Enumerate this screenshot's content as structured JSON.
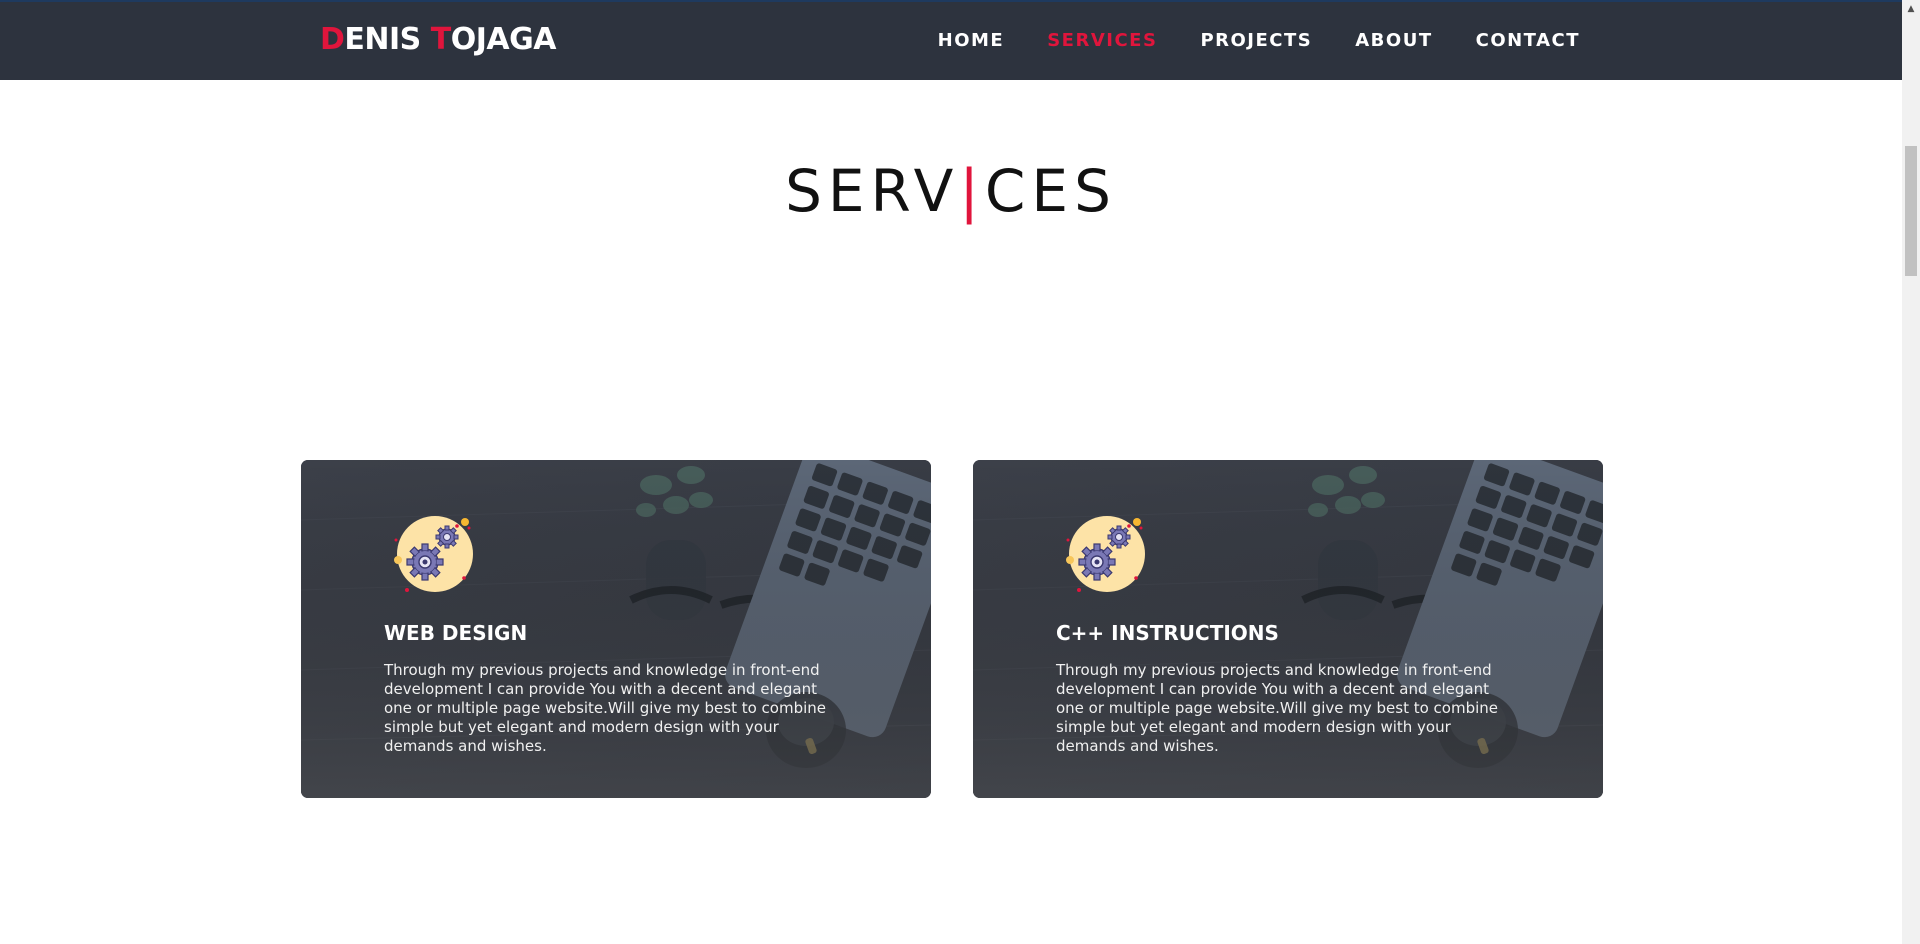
{
  "header": {
    "logo_first_initial": "D",
    "logo_first_rest": "ENIS ",
    "logo_last_initial": "T",
    "logo_last_rest": "OJAGA",
    "nav": [
      {
        "label": "HOME",
        "active": false
      },
      {
        "label": "SERVICES",
        "active": true
      },
      {
        "label": "PROJECTS",
        "active": false
      },
      {
        "label": "ABOUT",
        "active": false
      },
      {
        "label": "CONTACT",
        "active": false
      }
    ]
  },
  "section": {
    "title_left": "SERV",
    "title_bar": "|",
    "title_right": "CES"
  },
  "cards": [
    {
      "icon": "gears-icon",
      "title": "WEB DESIGN",
      "text": "Through my previous projects and knowledge in front-end development I can provide You with a decent and elegant one or multiple page website.Will give my best to combine simple but yet elegant and modern design with your demands and wishes."
    },
    {
      "icon": "gears-icon",
      "title": "C++ INSTRUCTIONS",
      "text": "Through my previous projects and knowledge in front-end development I can provide You with a decent and elegant one or multiple page website.Will give my best to combine simple but yet elegant and modern design with your demands and wishes."
    }
  ],
  "colors": {
    "accent": "#e0153c",
    "navbar": "#2d333e"
  }
}
